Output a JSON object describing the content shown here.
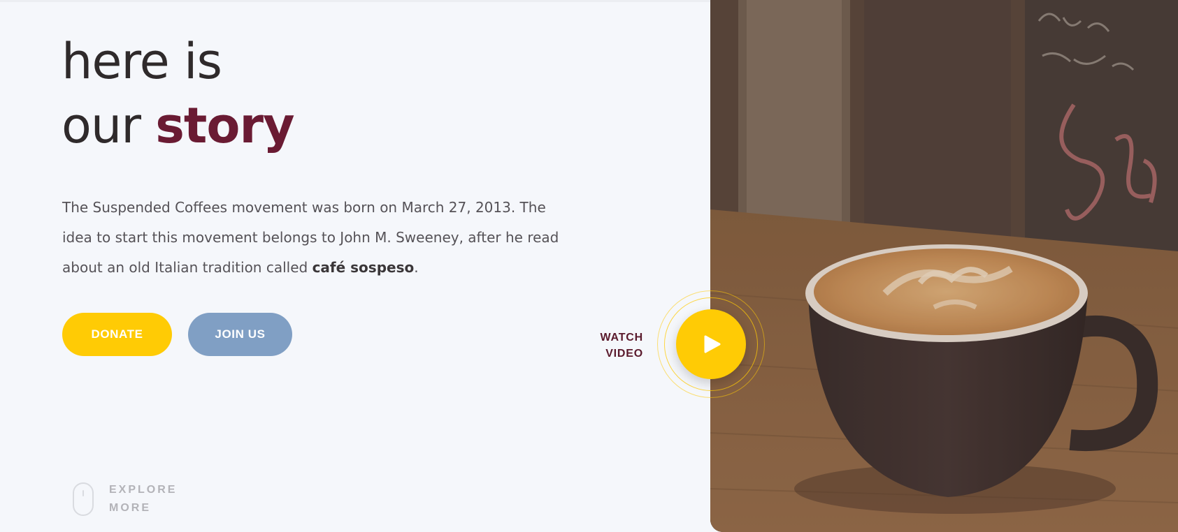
{
  "hero": {
    "title_line1": "here is",
    "title_line2_plain": "our",
    "title_line2_accent": "story",
    "intro_part1": "The Suspended Coffees movement was born on March 27, 2013. The idea to start this movement belongs to John M. Sweeney, after he read about an old Italian tradition called ",
    "intro_bold": "café sospeso",
    "intro_end": "."
  },
  "buttons": {
    "donate_label": "DONATE",
    "join_label": "JOIN US"
  },
  "video": {
    "watch_line1": "WATCH",
    "watch_line2": "VIDEO"
  },
  "explore": {
    "line1": "EXPLORE",
    "line2": "MORE"
  },
  "colors": {
    "accent": "#6a1b33",
    "primary_button": "#ffcb05",
    "secondary_button": "#809fc4",
    "background": "#f5f7fb"
  },
  "icons": {
    "play": "play-icon",
    "mouse": "mouse-icon"
  }
}
